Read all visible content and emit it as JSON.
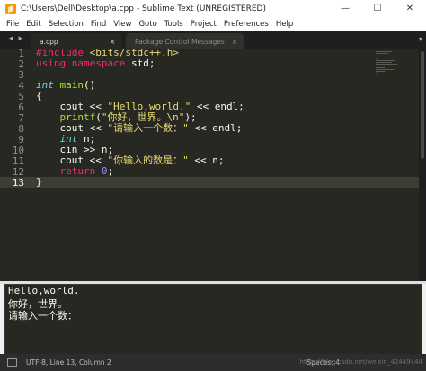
{
  "window": {
    "title": "C:\\Users\\Dell\\Desktop\\a.cpp - Sublime Text (UNREGISTERED)",
    "minimize": "—",
    "maximize": "☐",
    "close": "✕"
  },
  "menu": [
    "File",
    "Edit",
    "Selection",
    "Find",
    "View",
    "Goto",
    "Tools",
    "Project",
    "Preferences",
    "Help"
  ],
  "tabs": {
    "back": "◂",
    "forward": "▸",
    "active_label": "a.cpp",
    "active_close": "×",
    "inactive_label": "Package Control Messages",
    "inactive_close": "×",
    "overflow": "▾"
  },
  "editor": {
    "line_numbers": [
      "1",
      "2",
      "3",
      "4",
      "5",
      "6",
      "7",
      "8",
      "9",
      "10",
      "11",
      "12",
      "13"
    ],
    "current_line": "13",
    "code": {
      "l1_directive": "#include",
      "l1_header": "<bits/stdc++.h>",
      "l2_using": "using",
      "l2_namespace": "namespace",
      "l2_rest": "std;",
      "l4_type": "int",
      "l4_fn": "main",
      "l4_parens": "()",
      "l5": "{",
      "l6_a": "    cout << ",
      "l6_str": "\"Hello,world.\"",
      "l6_b": " << endl;",
      "l7_fn": "    printf",
      "l7_a": "(",
      "l7_str": "\"你好，世界。\\n\"",
      "l7_b": ");",
      "l8_a": "    cout << ",
      "l8_str": "\"请输入一个数：\"",
      "l8_b": " << endl;",
      "l9_type": "    int",
      "l9_b": " n;",
      "l10": "    cin >> n;",
      "l11_a": "    cout << ",
      "l11_str": "\"你输入的数是：\"",
      "l11_b": " << n;",
      "l12_kw": "    return",
      "l12_num": "0",
      "l12_b": ";",
      "l13": "}"
    }
  },
  "output": {
    "lines": [
      "Hello,world.",
      "你好，世界。",
      "请输入一个数："
    ]
  },
  "status": {
    "left": "UTF-8, Line 13, Column 2",
    "right": "Spaces: 4",
    "watermark": "https://blog.csdn.net/weixin_42449444"
  },
  "colors": {
    "editor_bg": "#272822",
    "keyword": "#f92672",
    "type": "#66d9ef",
    "function": "#a6e22e",
    "string": "#e6db74",
    "number": "#ae81ff"
  }
}
